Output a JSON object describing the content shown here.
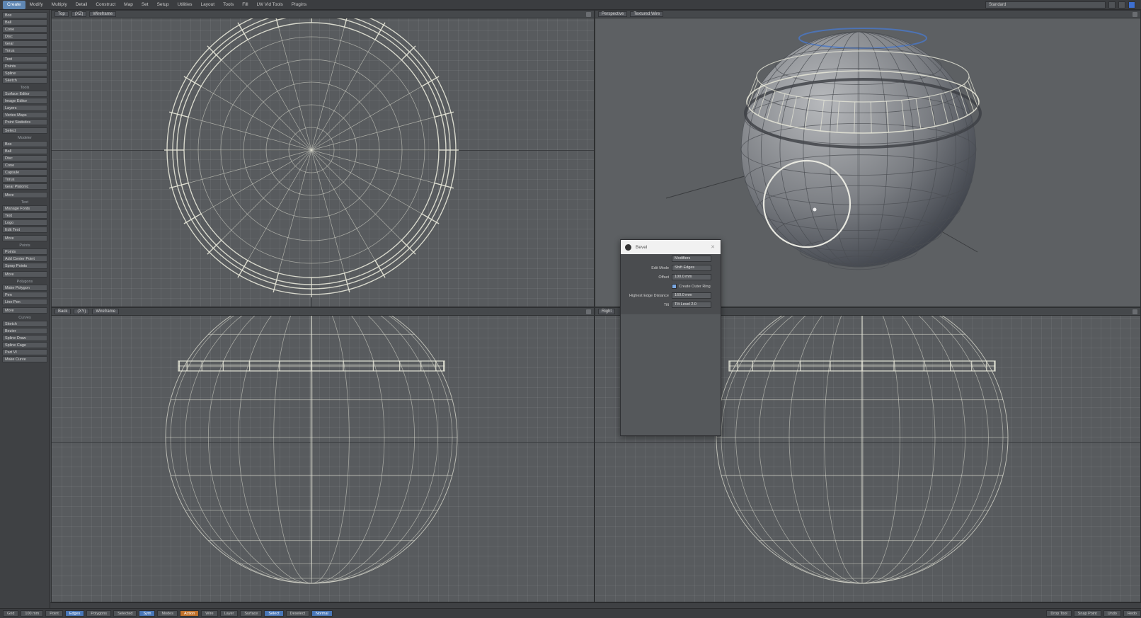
{
  "menubar": {
    "tabs": [
      {
        "label": "Create",
        "active": true
      },
      {
        "label": "Modify",
        "active": false
      },
      {
        "label": "Multiply",
        "active": false
      },
      {
        "label": "Detail",
        "active": false
      },
      {
        "label": "Construct",
        "active": false
      },
      {
        "label": "Map",
        "active": false
      },
      {
        "label": "Set",
        "active": false
      },
      {
        "label": "Setup",
        "active": false
      },
      {
        "label": "Utilities",
        "active": false
      },
      {
        "label": "Layout",
        "active": false
      },
      {
        "label": "Tools",
        "active": false
      },
      {
        "label": "Fill",
        "active": false
      },
      {
        "label": "LW Vid Tools",
        "active": false
      },
      {
        "label": "Plugins",
        "active": false
      }
    ],
    "right_combo": "Standard"
  },
  "toolbar": {
    "groups": [
      {
        "head": "",
        "items": [
          "Box",
          "Ball",
          "Cone",
          "Disc",
          "Gear",
          "Torus"
        ]
      },
      {
        "head": "",
        "items": [
          "Text",
          "Points",
          "Spline",
          "Sketch"
        ]
      },
      {
        "head": "Tools",
        "items": [
          "Surface Editor",
          "Image Editor",
          "Layers",
          "Vertex Maps",
          "Point Statistics"
        ]
      },
      {
        "head": "",
        "items": [
          "Select"
        ]
      },
      {
        "head": "Modeler",
        "items": [
          "Box",
          "Ball",
          "Disc",
          "Cone",
          "Capsule",
          "Torus",
          "Gear Platonic"
        ]
      },
      {
        "head": "",
        "items": [
          "More"
        ]
      },
      {
        "head": "Text",
        "items": [
          "Manage Fonts",
          "Text",
          "Logo",
          "Edit Text"
        ]
      },
      {
        "head": "",
        "items": [
          "More"
        ]
      },
      {
        "head": "Points",
        "items": [
          "Points",
          "Add Center Point",
          "Spray Points"
        ]
      },
      {
        "head": "",
        "items": [
          "More"
        ]
      },
      {
        "head": "Polygons",
        "items": [
          "Make Polygon",
          "Pen",
          "Line Pen"
        ]
      },
      {
        "head": "",
        "items": [
          "More"
        ]
      },
      {
        "head": "Curves",
        "items": [
          "Sketch",
          "Bezier",
          "Spline Draw",
          "Spline Cage",
          "Part VI",
          "Make Curve"
        ]
      }
    ]
  },
  "viewports": {
    "top": {
      "name": "Top",
      "mode": "(XZ)",
      "shading": "Wireframe"
    },
    "perspective": {
      "name": "Perspective",
      "shading": "Textured Wire"
    },
    "back": {
      "name": "Back",
      "mode": "(XY)",
      "shading": "Wireframe"
    },
    "right": {
      "name": "Right",
      "shading": ""
    }
  },
  "dialog": {
    "title": "Bevel",
    "preset": "Modifiers",
    "rows": [
      {
        "label": "Edit Mode",
        "value": "Shift Edges"
      },
      {
        "label": "Offset",
        "value": "100.0 mm"
      },
      {
        "label": "",
        "value": "Create Outer Ring",
        "checkbox": true
      },
      {
        "label": "Highest Edge Distance",
        "value": "160.0 mm"
      },
      {
        "label": "Tilt",
        "value": "Tilt Level 2.0"
      }
    ]
  },
  "statusbar": {
    "items": [
      {
        "label": "Grid",
        "style": "plain"
      },
      {
        "label": "100 mm",
        "style": "plain"
      },
      {
        "label": "Point",
        "style": "plain"
      },
      {
        "label": "Edges",
        "style": "blue"
      },
      {
        "label": "Polygons",
        "style": "plain"
      },
      {
        "label": "Selected",
        "style": "plain"
      },
      {
        "label": "Sym",
        "style": "blue"
      },
      {
        "label": "Modes",
        "style": "plain"
      },
      {
        "label": "Action",
        "style": "orange"
      },
      {
        "label": "Wire",
        "style": "plain"
      },
      {
        "label": "Layer",
        "style": "plain"
      },
      {
        "label": "Surface",
        "style": "plain"
      },
      {
        "label": "Select",
        "style": "blue"
      },
      {
        "label": "Deselect",
        "style": "plain"
      },
      {
        "label": "Normal",
        "style": "blue"
      }
    ],
    "right_items": [
      "Drop Tool",
      "Snap Point",
      "Undo",
      "Redo"
    ]
  },
  "colors": {
    "accent": "#5f87b3",
    "wire": "#e6e6d8",
    "background": "#585b5e"
  }
}
